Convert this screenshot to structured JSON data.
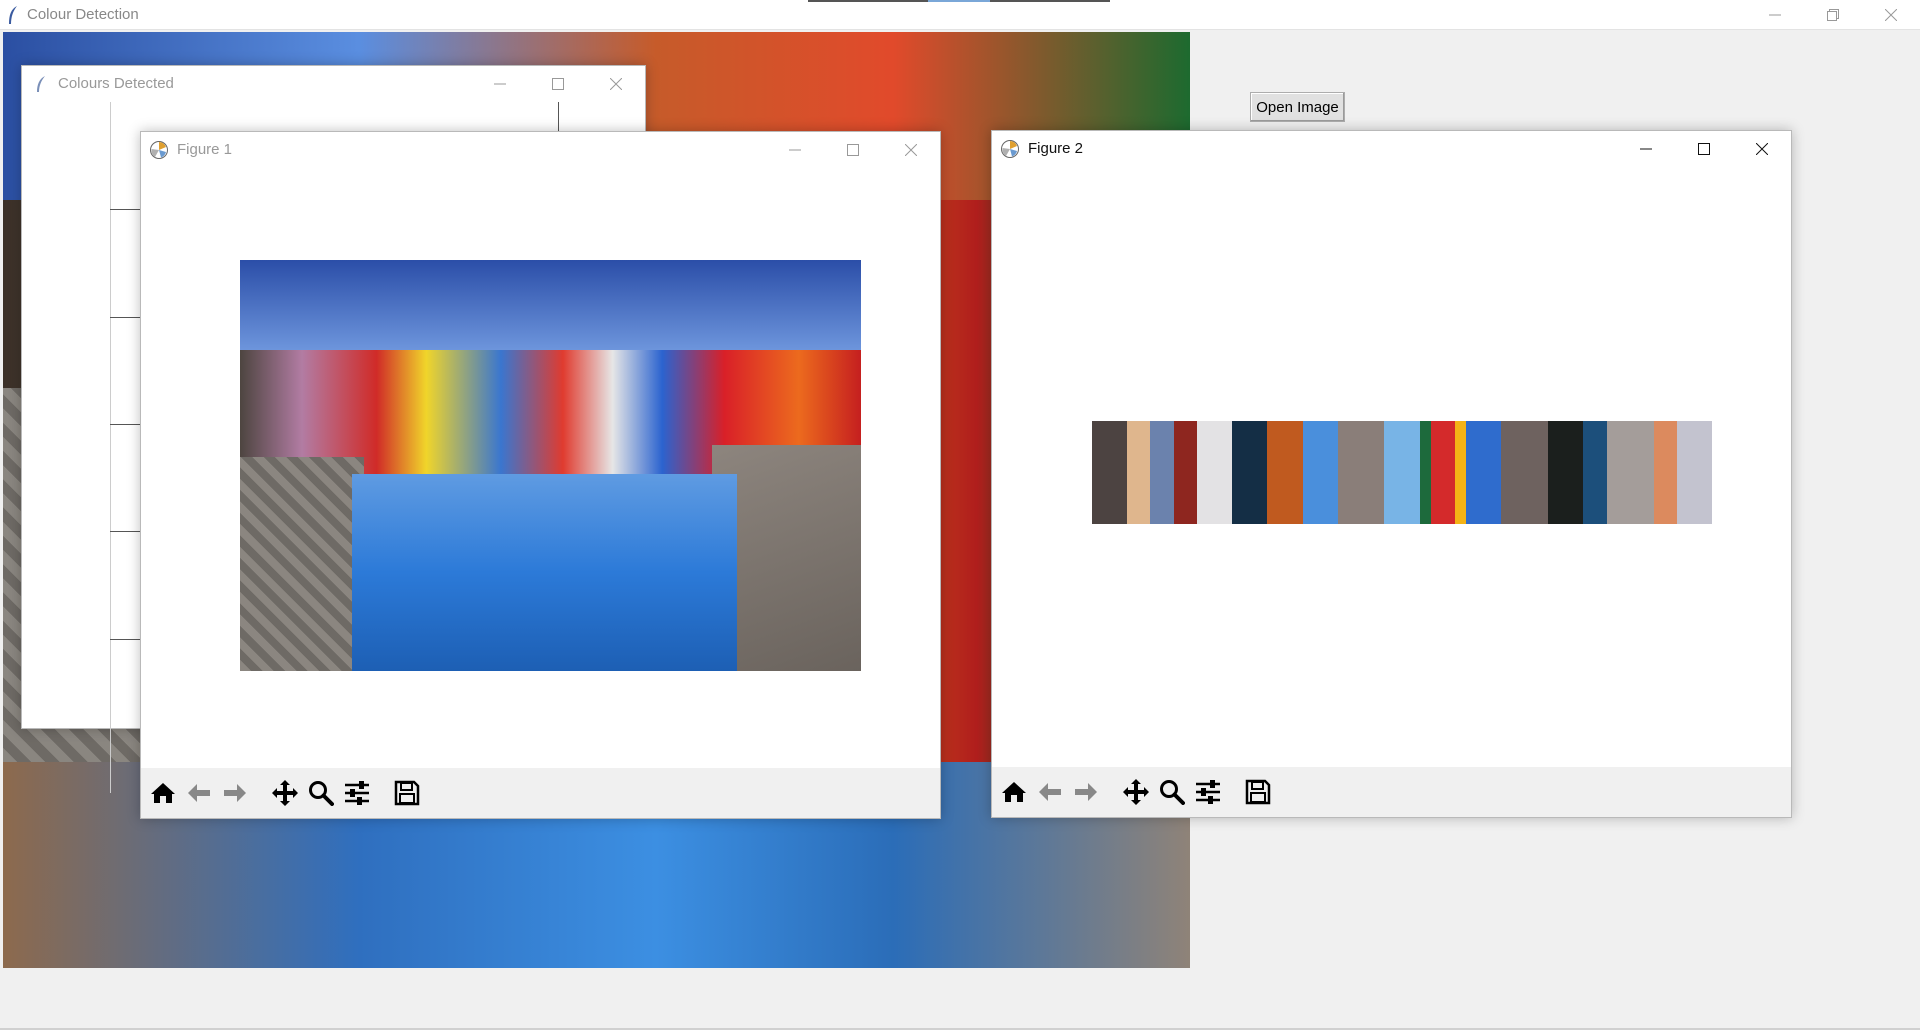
{
  "main_window": {
    "title": "Colour Detection",
    "open_button_label": "Open Image"
  },
  "colours_detected_window": {
    "title": "Colours Detected"
  },
  "figure1": {
    "title": "Figure 1"
  },
  "figure2": {
    "title": "Figure 2",
    "palette": [
      "#4c4341",
      "#dfb68d",
      "#6b82ad",
      "#8e261f",
      "#e3e2e4",
      "#142e45",
      "#c05a1f",
      "#4a8fdc",
      "#8a7e79",
      "#78b4e6",
      "#1d6a3c",
      "#d42a2b",
      "#f4b316",
      "#2f6ccd",
      "#6e625f",
      "#1b1f1d",
      "#1c4f7b",
      "#a49d9a",
      "#dc8a5e",
      "#c3c3cf"
    ],
    "palette_weights": [
      3,
      2,
      2,
      2,
      3,
      3,
      3,
      3,
      4,
      3,
      1,
      2,
      1,
      3,
      4,
      3,
      2,
      4,
      2,
      3
    ]
  },
  "toolbar": {
    "buttons": [
      "home-icon",
      "back-arrow-icon",
      "forward-arrow-icon",
      "pan-icon",
      "zoom-icon",
      "configure-subplots-icon",
      "save-icon"
    ]
  }
}
